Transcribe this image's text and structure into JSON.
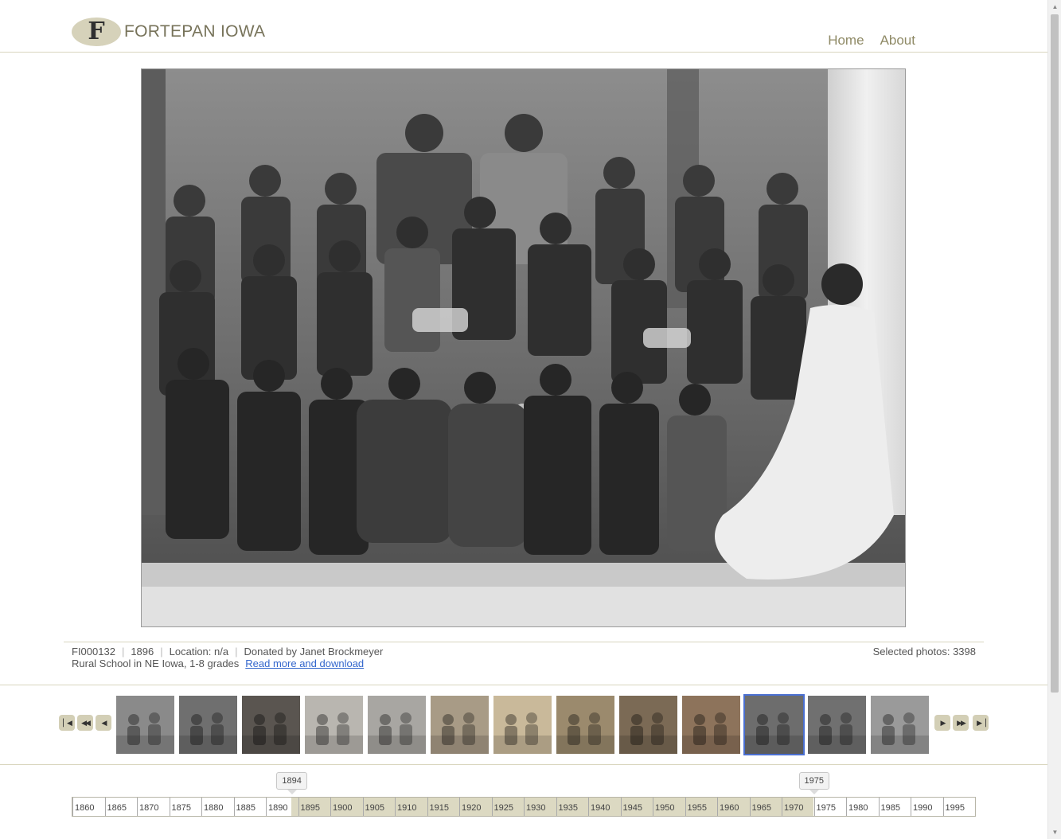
{
  "header": {
    "logo_letter": "F",
    "logo_text": "FORTEPAN IOWA",
    "nav": [
      {
        "label": "Home"
      },
      {
        "label": "About"
      }
    ]
  },
  "photo": {
    "id": "FI000132",
    "year": "1896",
    "location": "Location: n/a",
    "donor": "Donated by Janet Brockmeyer",
    "caption": "Rural School in NE Iowa, 1-8 grades",
    "read_more_label": "Read more and download",
    "selected_label": "Selected photos: 3398"
  },
  "strip": {
    "buttons_left": [
      "first-icon",
      "rewind-icon",
      "previous-icon"
    ],
    "buttons_right": [
      "next-icon",
      "fast-forward-icon",
      "last-icon"
    ],
    "thumbnails": [
      {
        "tone": "#8a8a8a",
        "active": false
      },
      {
        "tone": "#6f6f6f",
        "active": false
      },
      {
        "tone": "#5a5550",
        "active": false
      },
      {
        "tone": "#b9b6b0",
        "active": false
      },
      {
        "tone": "#a8a6a2",
        "active": false
      },
      {
        "tone": "#a89b86",
        "active": false
      },
      {
        "tone": "#c9b99a",
        "active": false
      },
      {
        "tone": "#9b8a6d",
        "active": false
      },
      {
        "tone": "#7b6a55",
        "active": false
      },
      {
        "tone": "#8d735b",
        "active": false
      },
      {
        "tone": "#6d6d6d",
        "active": true
      },
      {
        "tone": "#707070",
        "active": false
      },
      {
        "tone": "#9a9a9a",
        "active": false
      }
    ]
  },
  "timeline": {
    "years": [
      "1860",
      "1865",
      "1870",
      "1875",
      "1880",
      "1885",
      "1890",
      "1895",
      "1900",
      "1905",
      "1910",
      "1915",
      "1920",
      "1925",
      "1930",
      "1935",
      "1940",
      "1945",
      "1950",
      "1955",
      "1960",
      "1965",
      "1970",
      "1975",
      "1980",
      "1985",
      "1990",
      "1995"
    ],
    "range_start": "1894",
    "range_end": "1975",
    "range_start_year": 1894,
    "range_end_year": 1975
  },
  "colors": {
    "accent": "#8f8a66",
    "range_fill": "#dcd9c2",
    "link": "#3366cc",
    "active_thumb": "#4a6fd1"
  }
}
